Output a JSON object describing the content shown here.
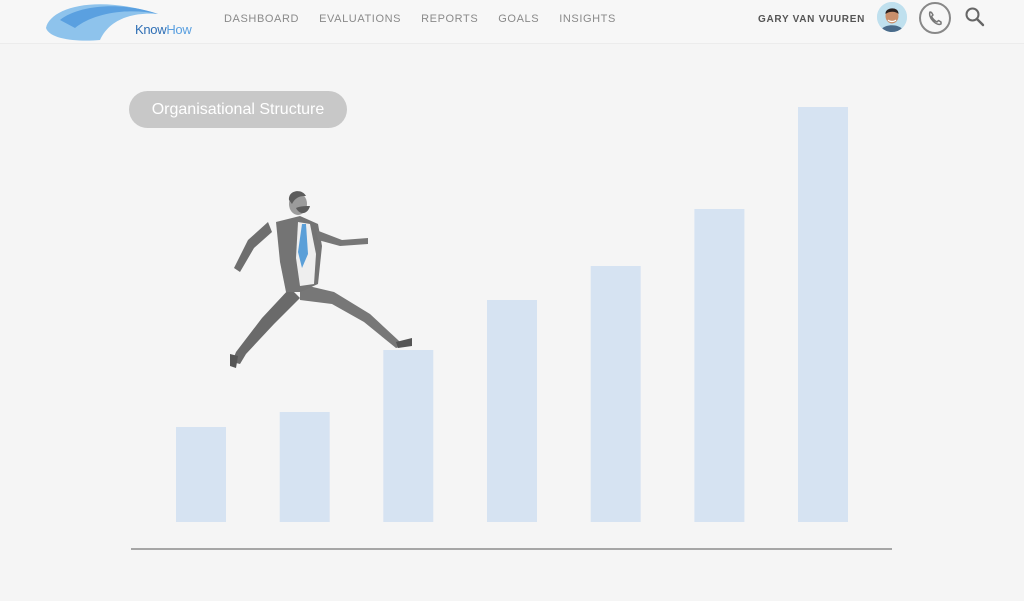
{
  "header": {
    "logo_text_part1": "Know",
    "logo_text_part2": "How",
    "nav": [
      "DASHBOARD",
      "EVALUATIONS",
      "REPORTS",
      "GOALS",
      "INSIGHTS"
    ],
    "user_name": "GARY VAN VUUREN",
    "icons": {
      "phone": "phone-icon",
      "search": "search-icon",
      "avatar": "avatar"
    }
  },
  "main": {
    "section_label": "Organisational Structure",
    "illustration": "businessman-running-icon"
  },
  "chart_data": {
    "type": "bar",
    "values": [
      95,
      110,
      172,
      222,
      256,
      313,
      415
    ],
    "ylim": [
      0,
      430
    ],
    "bar_color": "#d6e3f2",
    "axis_color": "#8c8c8c"
  },
  "colors": {
    "logo_swoosh": "#5aa0e0",
    "text_muted": "#8a8a8a",
    "tie": "#5a9fd8",
    "suit": "#747474"
  }
}
